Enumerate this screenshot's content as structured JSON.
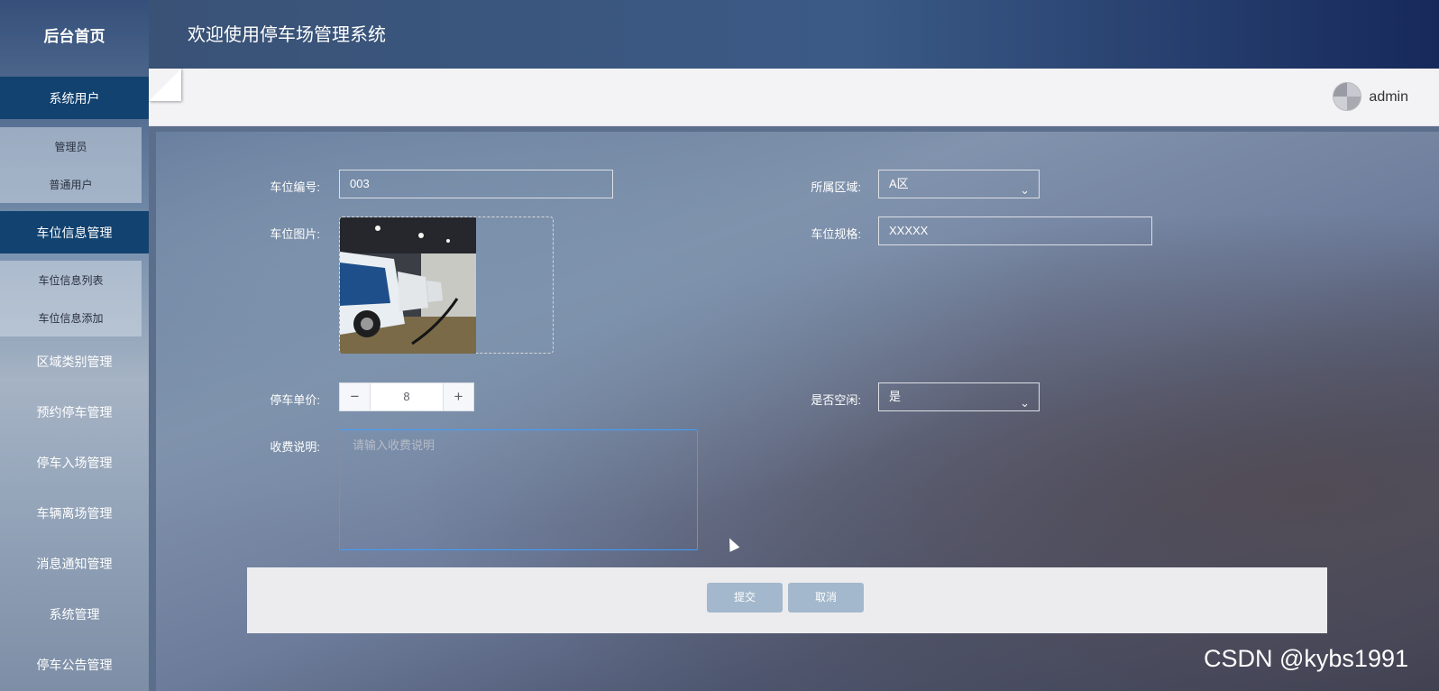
{
  "sidebar": {
    "home": "后台首页",
    "groups": [
      {
        "label": "系统用户",
        "subs": [
          "管理员",
          "普通用户"
        ]
      },
      {
        "label": "车位信息管理",
        "subs": [
          "车位信息列表",
          "车位信息添加"
        ]
      }
    ],
    "items": [
      "区域类别管理",
      "预约停车管理",
      "停车入场管理",
      "车辆离场管理",
      "消息通知管理",
      "系统管理",
      "停车公告管理"
    ]
  },
  "header": {
    "title": "欢迎使用停车场管理系统"
  },
  "topbar": {
    "user": "admin"
  },
  "form": {
    "space_no_label": "车位编号:",
    "space_no_value": "003",
    "area_label": "所属区域:",
    "area_value": "A区",
    "image_label": "车位图片:",
    "spec_label": "车位规格:",
    "spec_value": "XXXXX",
    "price_label": "停车单价:",
    "price_value": "8",
    "idle_label": "是否空闲:",
    "idle_value": "是",
    "fee_label": "收费说明:",
    "fee_placeholder": "请输入收费说明",
    "submit": "提交",
    "cancel": "取消"
  },
  "watermark": "CSDN @kybs1991"
}
